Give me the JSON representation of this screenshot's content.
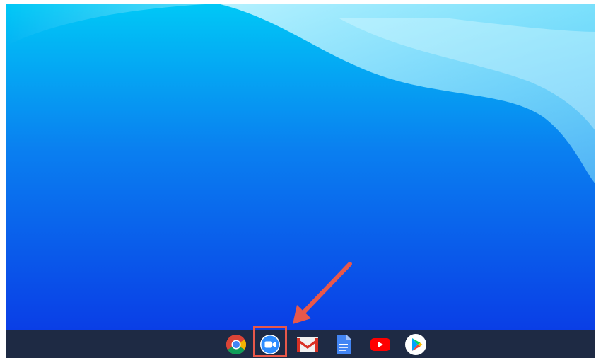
{
  "desktop": {
    "wallpaper_colors": {
      "top": "#00c6f5",
      "middle": "#0a6ff0",
      "bottom": "#0a3fe8",
      "wave": "#aeeefd"
    }
  },
  "shelf": {
    "background": "#1e2a44",
    "apps": [
      {
        "name": "chrome-icon"
      },
      {
        "name": "zoom-icon",
        "highlighted": true
      },
      {
        "name": "gmail-icon"
      },
      {
        "name": "google-docs-icon"
      },
      {
        "name": "youtube-icon"
      },
      {
        "name": "play-store-icon"
      }
    ]
  },
  "annotation": {
    "highlight_color": "#e8584a",
    "arrow_color": "#e8584a",
    "target": "zoom-icon"
  }
}
